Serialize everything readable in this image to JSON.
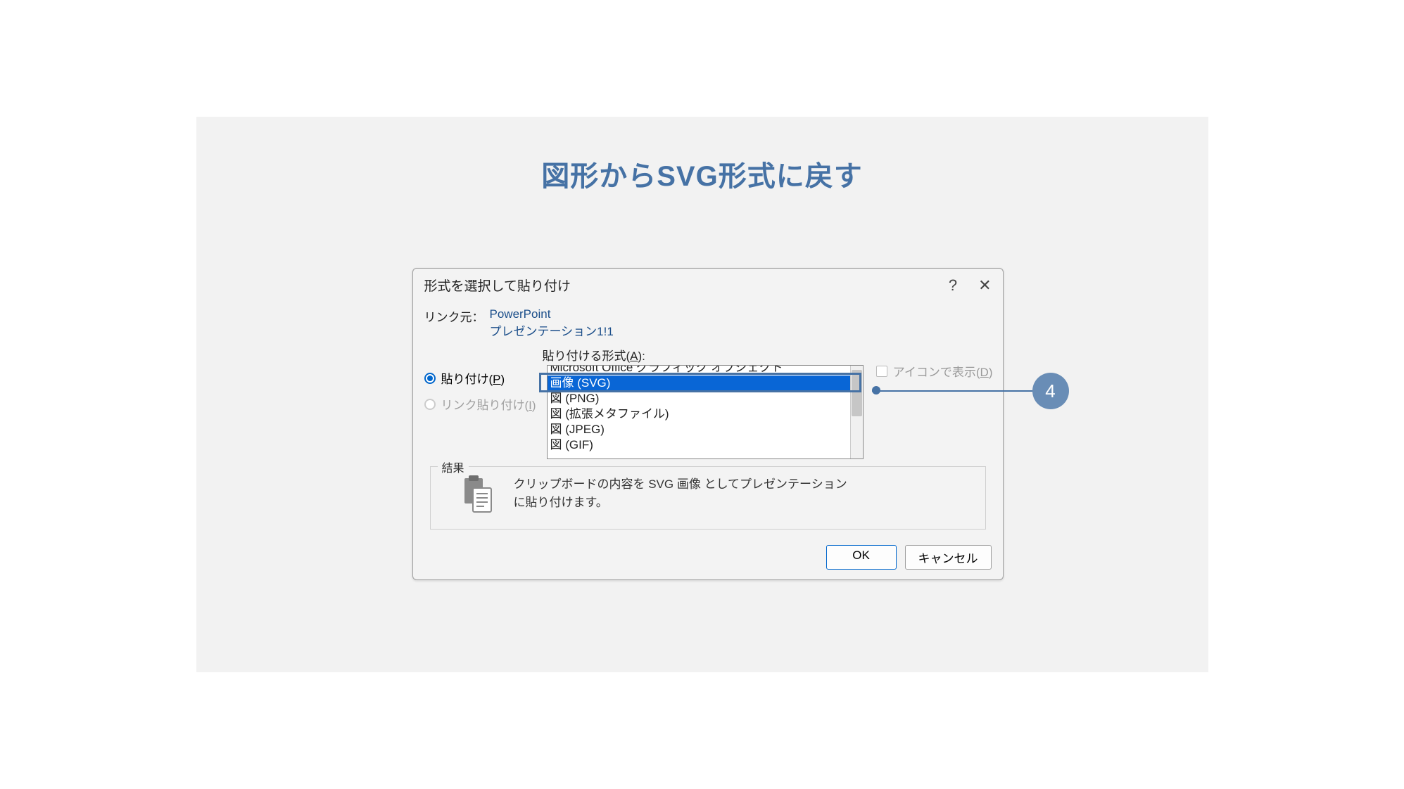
{
  "slide": {
    "title": "図形からSVG形式に戻す"
  },
  "callout": {
    "number": "4"
  },
  "dialog": {
    "title": "形式を選択して貼り付け",
    "linkSourceLabel": "リンク元：",
    "linkSource1": "PowerPoint",
    "linkSource2": "プレゼンテーション1!1",
    "formatLabelPrefix": "貼り付ける形式(",
    "formatLabelKey": "A",
    "formatLabelSuffix": "):",
    "radios": {
      "paste": {
        "prefix": "貼り付け(",
        "key": "P",
        "suffix": ")"
      },
      "pasteLink": {
        "prefix": "リンク貼り付け(",
        "key": "I",
        "suffix": ")"
      }
    },
    "formats": {
      "f0": "Microsoft Office グラフィック オブジェクト",
      "f1": "画像 (SVG)",
      "f2": "図 (PNG)",
      "f3": "図 (拡張メタファイル)",
      "f4": "図 (JPEG)",
      "f5": "図 (GIF)"
    },
    "displayAsIcon": {
      "prefix": "アイコンで表示(",
      "key": "D",
      "suffix": ")"
    },
    "result": {
      "label": "結果",
      "text": "クリップボードの内容を SVG 画像 としてプレゼンテーションに貼り付けます。"
    },
    "buttons": {
      "ok": "OK",
      "cancel": "キャンセル"
    }
  }
}
